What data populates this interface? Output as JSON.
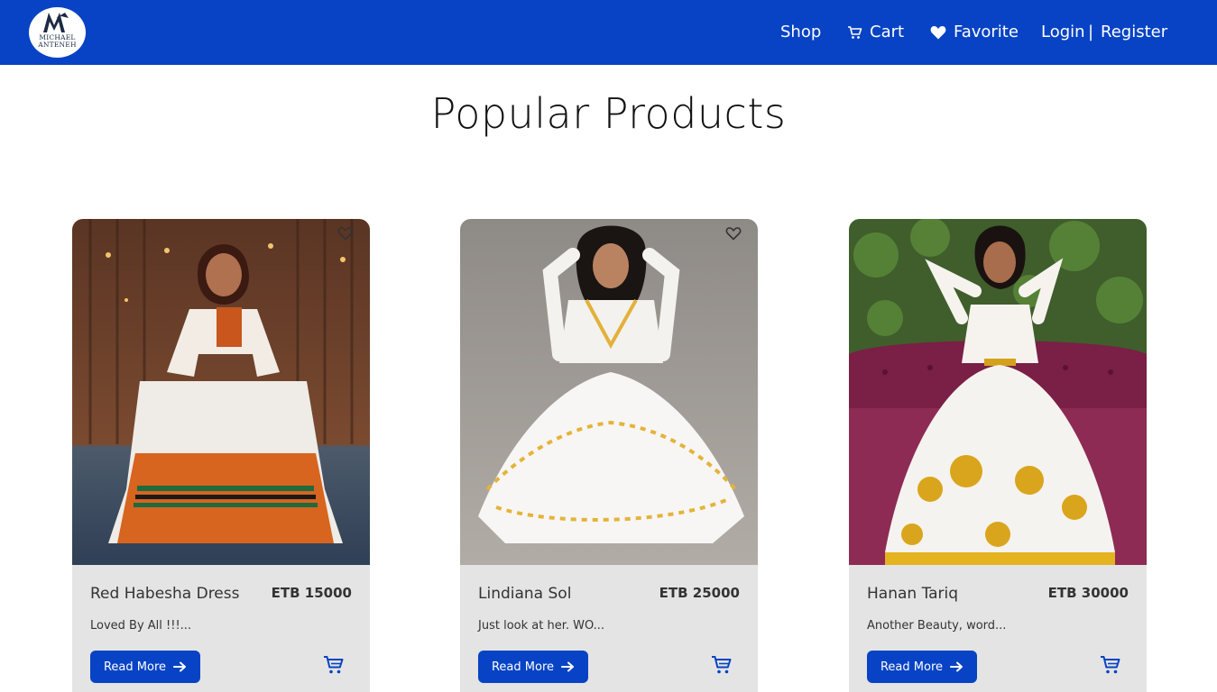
{
  "brand": {
    "logo_line1": "MICHAEL",
    "logo_line2": "ANTENEH",
    "color": "#0743c4"
  },
  "nav": {
    "shop": "Shop",
    "cart": "Cart",
    "favorite": "Favorite",
    "login": "Login",
    "separator": "|",
    "register": "Register"
  },
  "page": {
    "title": "Popular Products"
  },
  "products": [
    {
      "name": "Red Habesha Dress",
      "price": "ETB 15000",
      "description": "Loved By All !!!...",
      "read_more": "Read More",
      "image": "woman-in-white-and-orange-habesha-dress"
    },
    {
      "name": "Lindiana Sol",
      "price": "ETB 25000",
      "description": "Just look at her. WO...",
      "read_more": "Read More",
      "image": "woman-in-white-embroidered-dress"
    },
    {
      "name": "Hanan Tariq",
      "price": "ETB 30000",
      "description": "Another Beauty, word...",
      "read_more": "Read More",
      "image": "woman-in-white-and-gold-dress-on-sofa"
    }
  ]
}
